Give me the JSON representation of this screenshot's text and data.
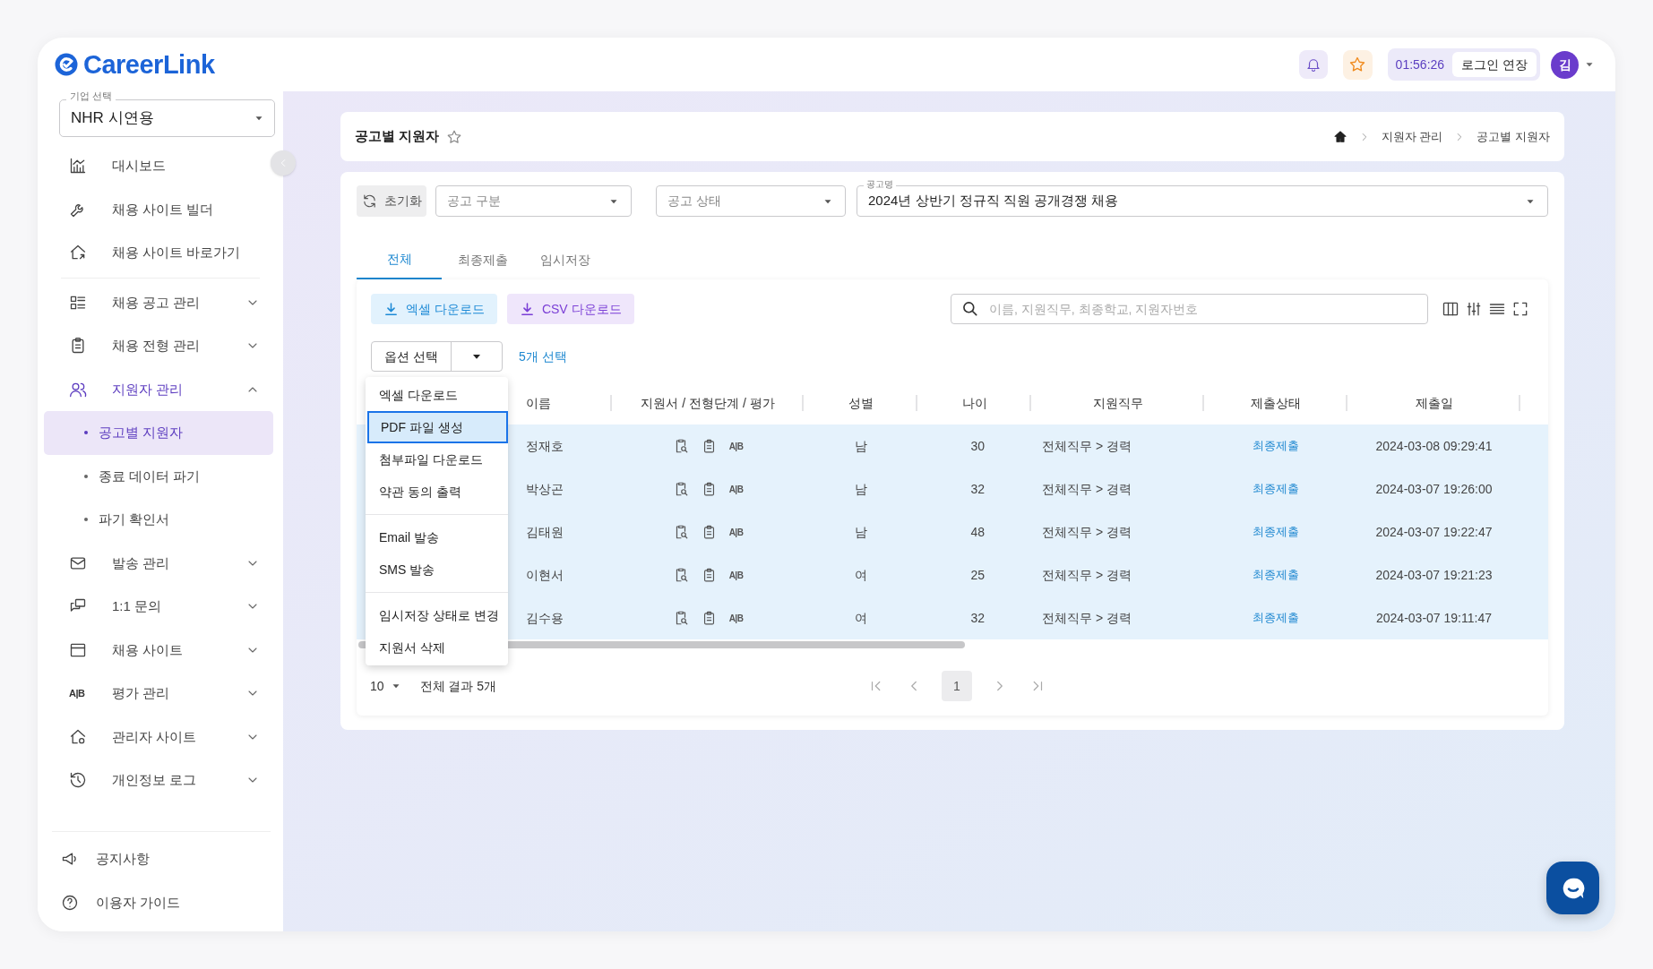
{
  "header": {
    "logo": "CareerLink",
    "timer": "01:56:26",
    "extend_button": "로그인 연장",
    "avatar": "김"
  },
  "sidebar": {
    "company_select": {
      "label": "기업 선택",
      "value": "NHR 시연용"
    },
    "menu": [
      {
        "label": "대시보드",
        "kind": "link",
        "selected": false
      },
      {
        "label": "채용 사이트 빌더",
        "kind": "link",
        "selected": false
      },
      {
        "label": "채용 사이트 바로가기",
        "kind": "link",
        "selected": false
      },
      {
        "label": "채용 공고 관리",
        "kind": "group",
        "selected": false,
        "expanded": false
      },
      {
        "label": "채용 전형 관리",
        "kind": "group",
        "selected": false,
        "expanded": false
      },
      {
        "label": "지원자 관리",
        "kind": "group",
        "selected": true,
        "expanded": true,
        "children": [
          {
            "label": "공고별 지원자",
            "selected": true
          },
          {
            "label": "종료 데이터 파기",
            "selected": false
          },
          {
            "label": "파기 확인서",
            "selected": false
          }
        ]
      },
      {
        "label": "발송 관리",
        "kind": "group",
        "selected": false,
        "expanded": false
      },
      {
        "label": "1:1 문의",
        "kind": "group",
        "selected": false,
        "expanded": false
      },
      {
        "label": "채용 사이트",
        "kind": "group",
        "selected": false,
        "expanded": false
      },
      {
        "label": "평가 관리",
        "kind": "group",
        "selected": false,
        "expanded": false,
        "icon_text": "A|B"
      },
      {
        "label": "관리자 사이트",
        "kind": "group",
        "selected": false,
        "expanded": false
      },
      {
        "label": "개인정보 로그",
        "kind": "group",
        "selected": false,
        "expanded": false
      }
    ],
    "footer": [
      {
        "label": "공지사항"
      },
      {
        "label": "이용자 가이드"
      }
    ]
  },
  "page": {
    "title": "공고별 지원자",
    "breadcrumb": [
      "지원자 관리",
      "공고별 지원자"
    ]
  },
  "filters": {
    "reset": "초기화",
    "selects": [
      {
        "placeholder": "공고 구분"
      },
      {
        "placeholder": "공고 상태"
      },
      {
        "label": "공고명",
        "value": "2024년 상반기 정규직 직원 공개경쟁 채용"
      }
    ]
  },
  "tabs": [
    {
      "label": "전체",
      "selected": true
    },
    {
      "label": "최종제출",
      "selected": false
    },
    {
      "label": "임시저장",
      "selected": false
    }
  ],
  "toolbar": {
    "excel_button": "엑셀 다운로드",
    "csv_button": "CSV 다운로드",
    "search": {
      "placeholder": "이름, 지원직무, 최종학교, 지원자번호"
    }
  },
  "options": {
    "label": "옵션 선택",
    "selection_count": "5개 선택",
    "menu": [
      [
        {
          "label": "엑셀 다운로드",
          "selected": false
        },
        {
          "label": "PDF 파일 생성",
          "selected": true
        },
        {
          "label": "첨부파일 다운로드",
          "selected": false
        },
        {
          "label": "약관 동의 출력",
          "selected": false
        }
      ],
      [
        {
          "label": "Email 발송",
          "selected": false
        },
        {
          "label": "SMS 발송",
          "selected": false
        }
      ],
      [
        {
          "label": "임시저장 상태로 변경",
          "selected": false
        },
        {
          "label": "지원서 삭제",
          "selected": false
        }
      ]
    ]
  },
  "table": {
    "columns": [
      "이름",
      "지원서 / 전형단계 / 평가",
      "성별",
      "나이",
      "지원직무",
      "제출상태",
      "제출일"
    ],
    "rows": [
      {
        "selected": true,
        "name": "정재호",
        "evaluation": "A|B",
        "gender": "남",
        "age": "30",
        "job": "전체직무 > 경력",
        "status": "최종제출",
        "submitted": "2024-03-08 09:29:41"
      },
      {
        "selected": true,
        "name": "박상곤",
        "evaluation": "A|B",
        "gender": "남",
        "age": "32",
        "job": "전체직무 > 경력",
        "status": "최종제출",
        "submitted": "2024-03-07 19:26:00"
      },
      {
        "selected": true,
        "name": "김태원",
        "evaluation": "A|B",
        "gender": "남",
        "age": "48",
        "job": "전체직무 > 경력",
        "status": "최종제출",
        "submitted": "2024-03-07 19:22:47"
      },
      {
        "selected": true,
        "name": "이현서",
        "evaluation": "A|B",
        "gender": "여",
        "age": "25",
        "job": "전체직무 > 경력",
        "status": "최종제출",
        "submitted": "2024-03-07 19:21:23"
      },
      {
        "selected": true,
        "name": "김수용",
        "evaluation": "A|B",
        "gender": "여",
        "age": "32",
        "job": "전체직무 > 경력",
        "status": "최종제출",
        "submitted": "2024-03-07 19:11:47"
      }
    ]
  },
  "pagination": {
    "page_size": "10",
    "total": "전체 결과 5개",
    "pages": [
      {
        "label": "1",
        "selected": true
      }
    ]
  }
}
